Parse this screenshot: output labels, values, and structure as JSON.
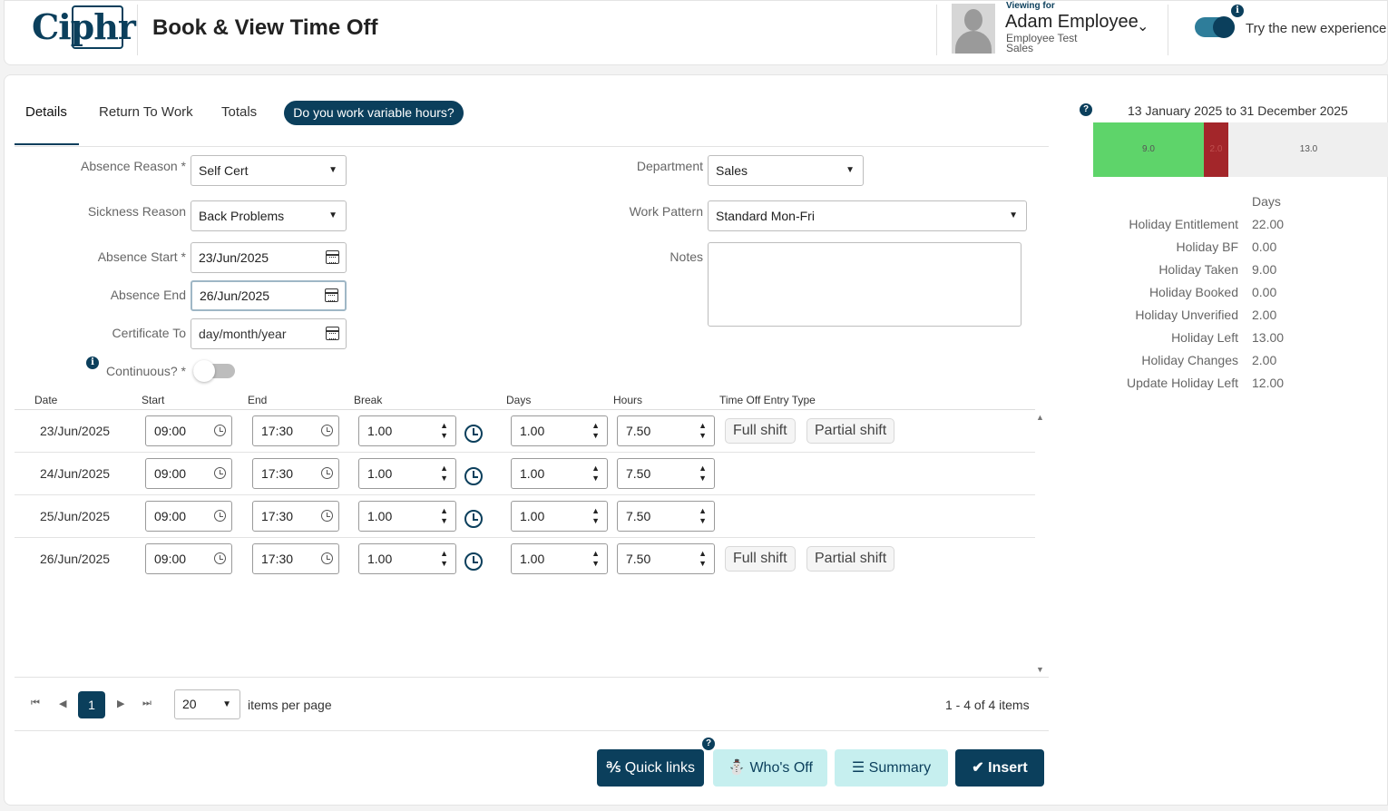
{
  "header": {
    "logo": "Ciphr",
    "title": "Book & View Time Off",
    "viewing_for": "Viewing for",
    "employee_name": "Adam Employee",
    "employee_sub1": "Employee Test",
    "employee_sub2": "Sales",
    "try_new": "Try the new experience"
  },
  "tabs": [
    "Details",
    "Return To Work",
    "Totals"
  ],
  "variable_hours_pill": "Do you work variable hours?",
  "form": {
    "absence_reason_label": "Absence Reason *",
    "absence_reason_value": "Self Cert",
    "sickness_reason_label": "Sickness Reason",
    "sickness_reason_value": "Back Problems",
    "absence_start_label": "Absence Start *",
    "absence_start_value": "23/Jun/2025",
    "absence_end_label": "Absence End",
    "absence_end_value": "26/Jun/2025",
    "certificate_to_label": "Certificate To",
    "certificate_to_placeholder": "day/month/year",
    "continuous_label": "Continuous? *",
    "department_label": "Department",
    "department_value": "Sales",
    "work_pattern_label": "Work Pattern",
    "work_pattern_value": "Standard Mon-Fri",
    "notes_label": "Notes"
  },
  "grid": {
    "columns": [
      "Date",
      "Start",
      "End",
      "Break",
      "Days",
      "Hours",
      "Time Off Entry Type"
    ],
    "rows": [
      {
        "date": "23/Jun/2025",
        "start": "09:00",
        "end": "17:30",
        "break": "1.00",
        "days": "1.00",
        "hours": "7.50"
      },
      {
        "date": "24/Jun/2025",
        "start": "09:00",
        "end": "17:30",
        "break": "1.00",
        "days": "1.00",
        "hours": "7.50"
      },
      {
        "date": "25/Jun/2025",
        "start": "09:00",
        "end": "17:30",
        "break": "1.00",
        "days": "1.00",
        "hours": "7.50"
      },
      {
        "date": "26/Jun/2025",
        "start": "09:00",
        "end": "17:30",
        "break": "1.00",
        "days": "1.00",
        "hours": "7.50"
      }
    ],
    "full_shift": "Full shift",
    "partial_shift": "Partial shift"
  },
  "pager": {
    "current_page": "1",
    "per_page": "20",
    "per_page_label": "items per page",
    "count_label": "1 - 4 of 4 items"
  },
  "actions": {
    "quick_links": "Quick links",
    "whos_off": "Who's Off",
    "summary": "Summary",
    "insert": "Insert"
  },
  "summary_panel": {
    "range": "13 January 2025 to 31 December 2025",
    "bar": [
      {
        "label": "9.0",
        "value": 9.0,
        "color": "#5ed46a"
      },
      {
        "label": "2.0",
        "value": 2.0,
        "color": "#a3262a"
      },
      {
        "label": "13.0",
        "value": 13.0,
        "color": "#efefef"
      }
    ],
    "days_header": "Days",
    "stats": [
      {
        "label": "Holiday Entitlement",
        "value": "22.00"
      },
      {
        "label": "Holiday BF",
        "value": "0.00"
      },
      {
        "label": "Holiday Taken",
        "value": "9.00"
      },
      {
        "label": "Holiday Booked",
        "value": "0.00"
      },
      {
        "label": "Holiday Unverified",
        "value": "2.00"
      },
      {
        "label": "Holiday Left",
        "value": "13.00"
      },
      {
        "label": "Holiday Changes",
        "value": "2.00"
      },
      {
        "label": "Update Holiday Left",
        "value": "12.00"
      }
    ]
  },
  "colors": {
    "brand": "#0b3f5c",
    "accent_light": "#c6efef"
  }
}
